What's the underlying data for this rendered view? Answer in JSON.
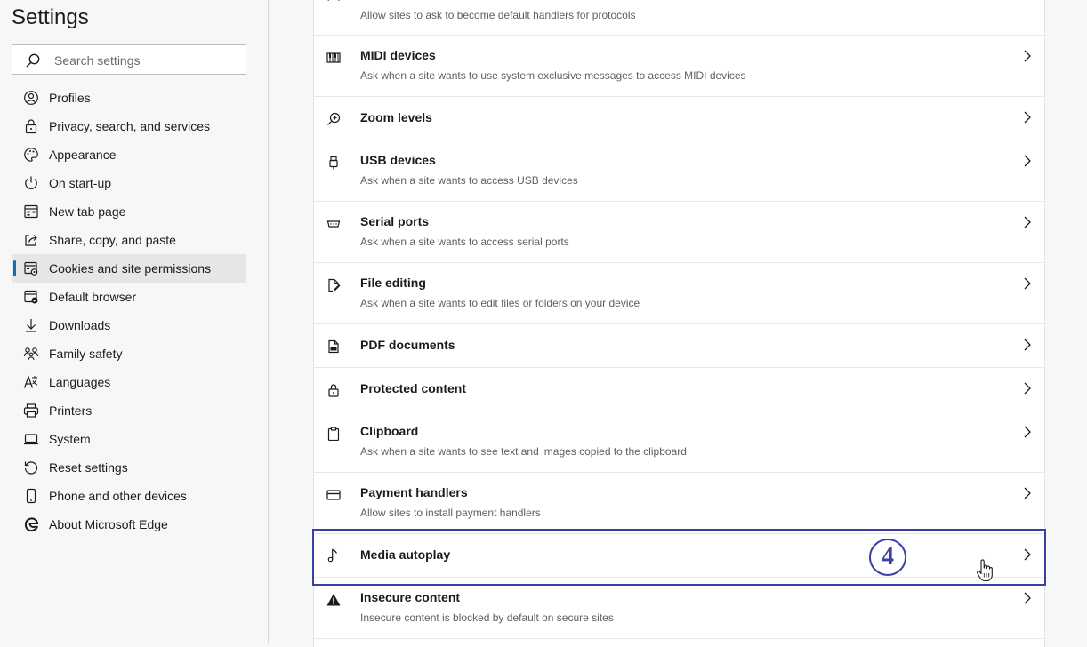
{
  "sidebar": {
    "title": "Settings",
    "search_placeholder": "Search settings",
    "items": [
      {
        "label": "Profiles",
        "icon": "profile-icon"
      },
      {
        "label": "Privacy, search, and services",
        "icon": "lock-icon"
      },
      {
        "label": "Appearance",
        "icon": "palette-icon"
      },
      {
        "label": "On start-up",
        "icon": "power-icon"
      },
      {
        "label": "New tab page",
        "icon": "new-tab-icon"
      },
      {
        "label": "Share, copy, and paste",
        "icon": "share-icon"
      },
      {
        "label": "Cookies and site permissions",
        "icon": "cookies-icon",
        "active": true
      },
      {
        "label": "Default browser",
        "icon": "default-browser-icon"
      },
      {
        "label": "Downloads",
        "icon": "download-icon"
      },
      {
        "label": "Family safety",
        "icon": "family-icon"
      },
      {
        "label": "Languages",
        "icon": "languages-icon"
      },
      {
        "label": "Printers",
        "icon": "printer-icon"
      },
      {
        "label": "System",
        "icon": "system-icon"
      },
      {
        "label": "Reset settings",
        "icon": "reset-icon"
      },
      {
        "label": "Phone and other devices",
        "icon": "phone-icon"
      },
      {
        "label": "About Microsoft Edge",
        "icon": "edge-icon"
      }
    ]
  },
  "permissions": [
    {
      "title": "",
      "desc": "Allow sites to ask to become default handlers for protocols",
      "icon": "protocol-icon"
    },
    {
      "title": "MIDI devices",
      "desc": "Ask when a site wants to use system exclusive messages to access MIDI devices",
      "icon": "midi-icon"
    },
    {
      "title": "Zoom levels",
      "desc": "",
      "icon": "zoom-icon"
    },
    {
      "title": "USB devices",
      "desc": "Ask when a site wants to access USB devices",
      "icon": "usb-icon"
    },
    {
      "title": "Serial ports",
      "desc": "Ask when a site wants to access serial ports",
      "icon": "serial-port-icon"
    },
    {
      "title": "File editing",
      "desc": "Ask when a site wants to edit files or folders on your device",
      "icon": "file-edit-icon"
    },
    {
      "title": "PDF documents",
      "desc": "",
      "icon": "pdf-icon"
    },
    {
      "title": "Protected content",
      "desc": "",
      "icon": "lock-icon"
    },
    {
      "title": "Clipboard",
      "desc": "Ask when a site wants to see text and images copied to the clipboard",
      "icon": "clipboard-icon"
    },
    {
      "title": "Payment handlers",
      "desc": "Allow sites to install payment handlers",
      "icon": "card-icon"
    },
    {
      "title": "Media autoplay",
      "desc": "",
      "icon": "music-note-icon"
    },
    {
      "title": "Insecure content",
      "desc": "Insecure content is blocked by default on secure sites",
      "icon": "warning-icon"
    }
  ],
  "annotation": {
    "step_number": "4",
    "color": "#3b3fa0"
  },
  "colors": {
    "accent": "#0f6cbd",
    "sidebar_bg": "#f7f7f7",
    "card_bg": "#ffffff"
  }
}
